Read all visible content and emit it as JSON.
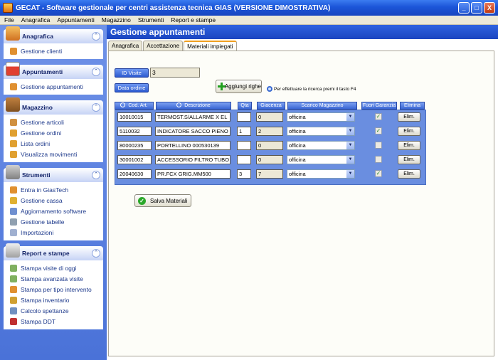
{
  "window": {
    "title": "GECAT - Software gestionale per centri assistenza tecnica GIAS  (VERSIONE DIMOSTRATIVA)",
    "buttons": {
      "minimize": "_",
      "maximize": "□",
      "close": "X"
    }
  },
  "menubar": [
    "File",
    "Anagrafica",
    "Appuntamenti",
    "Magazzino",
    "Strumenti",
    "Report e stampe"
  ],
  "sidebar": {
    "groups": [
      {
        "title": "Anagrafica",
        "icon": "people-icon",
        "items": [
          {
            "label": "Gestione clienti",
            "icon": "user-icon"
          }
        ]
      },
      {
        "title": "Appuntamenti",
        "icon": "calendar-icon",
        "items": [
          {
            "label": "Gestione appuntamenti",
            "icon": "user-icon"
          }
        ]
      },
      {
        "title": "Magazzino",
        "icon": "boxes-icon",
        "items": [
          {
            "label": "Gestione articoli",
            "icon": "box-icon"
          },
          {
            "label": "Gestione ordini",
            "icon": "box-icon"
          },
          {
            "label": "Lista ordini",
            "icon": "box-icon"
          },
          {
            "label": "Visualizza movimenti",
            "icon": "box-icon"
          }
        ]
      },
      {
        "title": "Strumenti",
        "icon": "tools-icon",
        "items": [
          {
            "label": "Entra in GiasTech",
            "icon": "user-icon"
          },
          {
            "label": "Gestione cassa",
            "icon": "cash-icon"
          },
          {
            "label": "Aggiornamento software",
            "icon": "update-icon"
          },
          {
            "label": "Gestione tabelle",
            "icon": "table-icon"
          },
          {
            "label": "Importazioni",
            "icon": "import-icon"
          }
        ]
      },
      {
        "title": "Report e stampe",
        "icon": "printer-icon",
        "items": [
          {
            "label": "Stampa visite di oggi",
            "icon": "report-icon"
          },
          {
            "label": "Stampa avanzata visite",
            "icon": "report-icon"
          },
          {
            "label": "Stampa per tipo intervento",
            "icon": "user-icon"
          },
          {
            "label": "Stampa inventario",
            "icon": "box-icon"
          },
          {
            "label": "Calcolo spettanze",
            "icon": "calc-icon"
          },
          {
            "label": "Stampa DDT",
            "icon": "truck-icon"
          }
        ]
      }
    ],
    "collapse_glyph": "⌃"
  },
  "main": {
    "title": "Gestione appuntamenti",
    "tabs": [
      "Anagrafica",
      "Accettazione",
      "Materiali impiegati"
    ],
    "active_tab": 2,
    "id_visite_label": "ID Visite",
    "id_visite_value": "3",
    "data_ordine_label": "Data ordine",
    "add_rows_label": "Aggiungi righe",
    "hint": "Per effettuare la ricerca premi il tasto F4",
    "columns": {
      "cod_art": "Cod. Art.",
      "descrizione": "Descrizione",
      "qta": "Qta",
      "giacenza": "Giacenza",
      "scarico": "Scarico Magazzino",
      "fuori_garanzia": "Fuori Garanzia",
      "elimina": "Elimina"
    },
    "rows": [
      {
        "cod": "10010015",
        "desc": "TERMOST.S/ALLARME X EL",
        "qta": "",
        "giacenza": "0",
        "scarico": "officina",
        "fuori_garanzia": true,
        "elim": "Elim."
      },
      {
        "cod": "5110032",
        "desc": "INDICATORE SACCO PIENO",
        "qta": "1",
        "giacenza": "2",
        "scarico": "officina",
        "fuori_garanzia": true,
        "elim": "Elim."
      },
      {
        "cod": "80000235",
        "desc": "PORTELLINO 000530139",
        "qta": "",
        "giacenza": "0",
        "scarico": "officina",
        "fuori_garanzia": false,
        "elim": "Elim."
      },
      {
        "cod": "30001002",
        "desc": "ACCESSORIO FILTRO TUBO",
        "qta": "",
        "giacenza": "0",
        "scarico": "officina",
        "fuori_garanzia": false,
        "elim": "Elim."
      },
      {
        "cod": "20040630",
        "desc": "PR.FCX GRIG.MM500",
        "qta": "3",
        "giacenza": "7",
        "scarico": "officina",
        "fuori_garanzia": true,
        "elim": "Elim."
      }
    ],
    "save_label": "Salva Materiali"
  },
  "colors": {
    "titlebar": "#1b55d8",
    "sidebar_bg": "#5a80e0",
    "accent_blue": "#2d5bd0",
    "grid_bg": "#6a8ee0"
  }
}
